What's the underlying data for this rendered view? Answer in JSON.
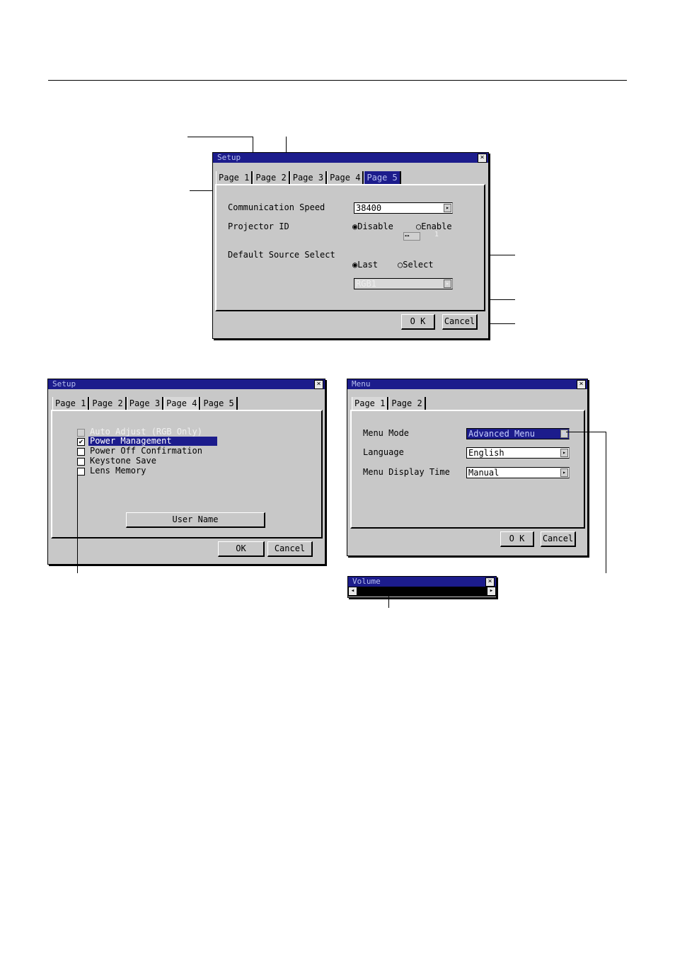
{
  "setup_p5": {
    "title": "Setup",
    "close": "×",
    "tabs": [
      "Page 1",
      "Page 2",
      "Page 3",
      "Page 4",
      "Page 5"
    ],
    "comm_speed_label": "Communication Speed",
    "comm_speed_value": "38400",
    "projector_id_label": "Projector ID",
    "disable_label": "Disable",
    "enable_label": "Enable",
    "id_value": "1",
    "default_source_label": "Default Source Select",
    "last_label": "Last",
    "select_label": "Select",
    "source_value": "RGB1",
    "ok": "O K",
    "cancel": "Cancel"
  },
  "setup_p4": {
    "title": "Setup",
    "close": "×",
    "tabs": [
      "Page 1",
      "Page 2",
      "Page 3",
      "Page 4",
      "Page 5"
    ],
    "options": [
      {
        "label": "Auto Adjust (RGB Only)",
        "checked": false,
        "disabled": true
      },
      {
        "label": "Power Management",
        "checked": true,
        "disabled": false
      },
      {
        "label": "Power Off Confirmation",
        "checked": false,
        "disabled": false
      },
      {
        "label": "Keystone Save",
        "checked": false,
        "disabled": false
      },
      {
        "label": "Lens Memory",
        "checked": false,
        "disabled": false
      }
    ],
    "user_name": "User Name",
    "ok": "OK",
    "cancel": "Cancel"
  },
  "menu": {
    "title": "Menu",
    "close": "×",
    "tabs": [
      "Page 1",
      "Page 2"
    ],
    "mode_label": "Menu Mode",
    "mode_value": "Advanced Menu",
    "lang_label": "Language",
    "lang_value": "English",
    "time_label": "Menu Display Time",
    "time_value": "Manual",
    "ok": "O K",
    "cancel": "Cancel"
  },
  "volume": {
    "title": "Volume",
    "close": "×"
  },
  "icons": {
    "check": "✔",
    "arrow_right": "▸",
    "arrow_left": "◂"
  },
  "colors": {
    "titlebar": "#1c1c8c",
    "dialog": "#c8c8c8"
  }
}
